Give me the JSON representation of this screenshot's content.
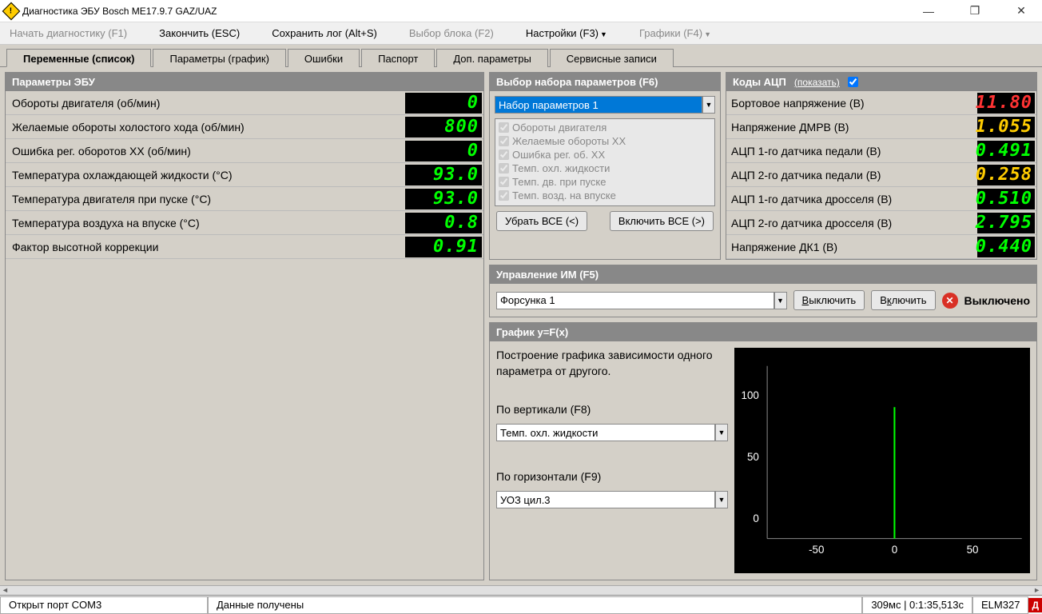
{
  "title": "Диагностика ЭБУ Bosch ME17.9.7 GAZ/UAZ",
  "menu": {
    "start": "Начать диагностику (F1)",
    "finish": "Закончить (ESC)",
    "savelog": "Сохранить лог (Alt+S)",
    "selectblock": "Выбор блока (F2)",
    "settings": "Настройки (F3)",
    "charts": "Графики (F4)"
  },
  "tabs": {
    "vars": "Переменные (список)",
    "params": "Параметры (график)",
    "errors": "Ошибки",
    "passport": "Паспорт",
    "addparams": "Доп. параметры",
    "service": "Сервисные записи"
  },
  "ecu": {
    "header": "Параметры ЭБУ",
    "rows": [
      {
        "label": "Обороты двигателя (об/мин)",
        "value": "0"
      },
      {
        "label": "Желаемые обороты холостого хода (об/мин)",
        "value": "800"
      },
      {
        "label": "Ошибка рег. оборотов ХХ (об/мин)",
        "value": "0"
      },
      {
        "label": "Температура охлаждающей жидкости (°C)",
        "value": "93.0"
      },
      {
        "label": "Температура двигателя при пуске (°C)",
        "value": "93.0"
      },
      {
        "label": "Температура воздуха на впуске (°C)",
        "value": "0.8"
      },
      {
        "label": "Фактор высотной коррекции",
        "value": "0.91"
      }
    ]
  },
  "paramset": {
    "header": "Выбор набора параметров (F6)",
    "selected": "Набор параметров 1",
    "items": [
      "Обороты двигателя",
      "Желаемые обороты ХХ",
      "Ошибка рег. об. ХХ",
      "Темп. охл. жидкости",
      "Темп. дв. при пуске",
      "Темп. возд. на впуске"
    ],
    "remove_all": "Убрать ВСЕ (<)",
    "add_all": "Включить ВСЕ (>)"
  },
  "codes": {
    "header": "Коды АЦП",
    "showlabel": "(показать)",
    "rows": [
      {
        "label": "Бортовое напряжение (В)",
        "value": "11.80",
        "color": "red"
      },
      {
        "label": "Напряжение ДМРВ (В)",
        "value": "1.055",
        "color": "yellow"
      },
      {
        "label": "АЦП 1-го датчика педали (В)",
        "value": "0.491",
        "color": "green"
      },
      {
        "label": "АЦП 2-го датчика педали (В)",
        "value": "0.258",
        "color": "yellow"
      },
      {
        "label": "АЦП 1-го датчика дросселя (В)",
        "value": "0.510",
        "color": "green"
      },
      {
        "label": "АЦП 2-го датчика дросселя (В)",
        "value": "2.795",
        "color": "green"
      },
      {
        "label": "Напряжение ДК1 (В)",
        "value": "0.440",
        "color": "green"
      }
    ]
  },
  "im": {
    "header": "Управление ИМ (F5)",
    "selected": "Форсунка 1",
    "off": "Выключить",
    "on": "Включить",
    "status": "Выключено"
  },
  "graph": {
    "header": "График y=F(x)",
    "desc": "Построение графика зависимости одного параметра от другого.",
    "vlabel": "По вертикали (F8)",
    "vvalue": "Темп. охл. жидкости",
    "hlabel": "По горизонтали (F9)",
    "hvalue": "УОЗ цил.3"
  },
  "chart_data": {
    "type": "scatter",
    "xlabel": "УОЗ цил.3",
    "ylabel": "Темп. охл. жидкости",
    "xlim": [
      -75,
      75
    ],
    "ylim": [
      -20,
      120
    ],
    "xticks": [
      -50,
      0,
      50
    ],
    "yticks": [
      0,
      50,
      100
    ],
    "series": [
      {
        "name": "data",
        "x": [
          0
        ],
        "y": [
          93
        ]
      }
    ]
  },
  "status": {
    "port": "Открыт порт COM3",
    "data": "Данные получены",
    "timing": "309мс | 0:1:35,513с",
    "adapter": "ELM327",
    "badge": "Д"
  }
}
